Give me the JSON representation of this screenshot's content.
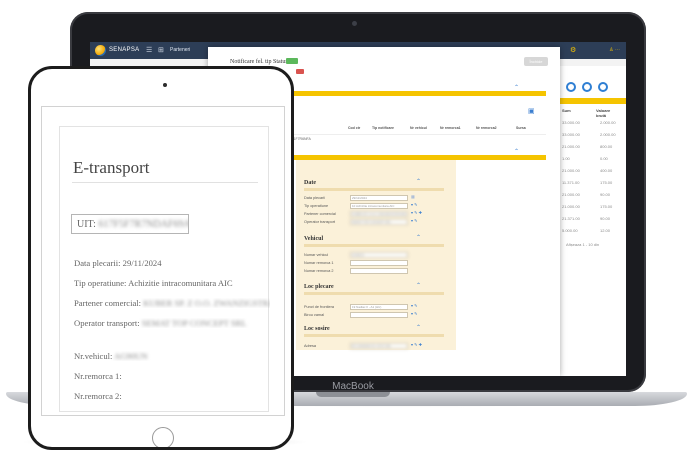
{
  "laptop": {
    "brand_label": "MacBook",
    "app": {
      "brand": "SENAPSA",
      "menu_item": "Parteneri",
      "modal_title": "Notificare fel. tip Status",
      "modal_badge": "Nou",
      "modal_button": "Închide",
      "table_headers": [
        "Data inscriere",
        "Stare",
        "UIT",
        "Cod ctr",
        "Tip notificare",
        "Nr vehicul",
        "Nr remorca1",
        "Nr remorca2",
        "Sursa"
      ],
      "table_row": [
        "29/11/2024",
        "4",
        "21711F7R6NFA",
        "",
        "",
        "",
        "",
        "",
        ""
      ],
      "side_values": [
        {
          "a": "33.000.00",
          "b": "2.000.00"
        },
        {
          "a": "33.000.00",
          "b": "2.000.00"
        },
        {
          "a": "21.000.00",
          "b": "800.00"
        },
        {
          "a": "1.00",
          "b": "0.00"
        },
        {
          "a": "21.000.00",
          "b": "400.00"
        },
        {
          "a": "11.371.00",
          "b": "175.00"
        },
        {
          "a": "21.000.00",
          "b": "90.00"
        },
        {
          "a": "21.000.00",
          "b": "175.00"
        },
        {
          "a": "21.371.00",
          "b": "90.00"
        },
        {
          "a": "5.000.00",
          "b": "12.00"
        }
      ],
      "side_headers": [
        "Sum",
        "Valoare brută"
      ],
      "pagination": "Afișeaza 1 - 10 din",
      "form": {
        "sections": {
          "date": "Date",
          "vehicul": "Vehicul",
          "loc_plecare": "Loc plecare",
          "loc_sosire": "Loc sosire"
        },
        "fields": {
          "data_plecarii": {
            "label": "Data plecarii",
            "value": "29/11/2024"
          },
          "tip_operatiune": {
            "label": "Tip operatiune",
            "value": "10 Achizitie intracomunitara AIC"
          },
          "partener_comercial": {
            "label": "Partener comercial",
            "value": "KUBER SP. Z O.O. ZWANZIGSTRASSE"
          },
          "operator_transport": {
            "label": "Operator transport",
            "value": "SEMAT TOP CONCEPT SRL"
          },
          "numar_vehicul": {
            "label": "Numar vehicul",
            "value": "AG90UN"
          },
          "numar_remorca_1": {
            "label": "Numar remorca 1",
            "value": ""
          },
          "numar_remorca_2": {
            "label": "Numar remorca 2",
            "value": ""
          },
          "punct_frontiera": {
            "label": "Punct de frontiera",
            "value": "19 Nadlac II - A1 (HU)"
          },
          "birou_vamal": {
            "label": "Birou vamal",
            "value": ""
          },
          "adresa": {
            "label": "Adresa",
            "value": "RO 22000000 SC XXXX SRL"
          }
        }
      }
    }
  },
  "tablet": {
    "title": "E-transport",
    "uit_label": "UIT:",
    "uit_value": "617F5F7R7NDAF69A",
    "lines": [
      {
        "label": "Data plecarii: ",
        "value": "29/11/2024",
        "blurred": false
      },
      {
        "label": "Tip operatiune: ",
        "value": "Achizitie intracomunitara AIC",
        "blurred": false
      },
      {
        "label": "Partener comercial: ",
        "value": "KUBER SP. Z O.O. ZWANZIGSTRASSE",
        "blurred": true
      },
      {
        "label": "Operator transport: ",
        "value": "SEMAT TOP CONCEPT SRL",
        "blurred": true
      },
      {
        "label": "Nr.vehicul: ",
        "value": "AG90UN",
        "blurred": true
      },
      {
        "label": "Nr.remorca 1:",
        "value": "",
        "blurred": false
      },
      {
        "label": "Nr.remorca 2:",
        "value": "",
        "blurred": false
      }
    ]
  },
  "colors": {
    "accent_yellow": "#f5c400",
    "topbar_navy": "#2d3e57",
    "form_bg": "#fbf1d9",
    "link_blue": "#3b7fd0"
  }
}
